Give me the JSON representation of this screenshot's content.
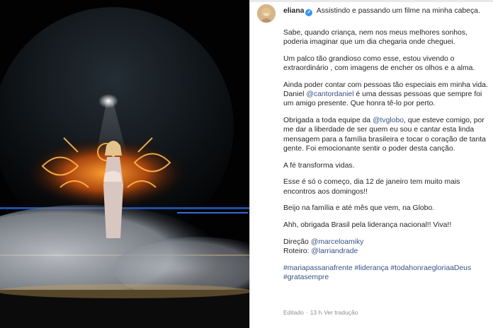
{
  "post": {
    "username": "eliana",
    "first_line": "Assistindo e passando um filme na minha cabeça.",
    "p1": "Sabe, quando criança, nem nos meus melhores sonhos, poderia imaginar que um dia chegaria onde cheguei.",
    "p2": "Um palco tão grandioso como esse, estou vivendo o extraordinário , com imagens de encher os olhos e a alma.",
    "p3_a": "Ainda poder contar com pessoas tão especiais em minha vida. Daniel ",
    "p3_mention": "@cantordaniel",
    "p3_b": " é uma dessas pessoas que sempre foi um amigo presente. Que honra tê-lo por perto.",
    "p4_a": "Obrigada a toda equipe da ",
    "p4_mention": "@tvglobo",
    "p4_b": ", que esteve comigo, por me dar a liberdade de ser quem eu sou e cantar esta linda mensagem para a família brasileira e tocar o coração de tanta gente. Foi emocionante sentir o poder desta canção.",
    "p5": "A fé transforma vidas.",
    "p6": "Esse é só o começo, dia 12 de janeiro tem muito mais encontros aos domingos!!",
    "p7": "Beijo na família e até mês que vem, na Globo.",
    "p8": "Ahh, obrigada Brasil pela liderança nacional!! Viva!!",
    "credit1_label": "Direção ",
    "credit1_mention": "@marceloamiky",
    "credit2_label": "Roteiro: ",
    "credit2_mention": "@larriandrade",
    "hashtags_line1": "#mariapassanafrente #liderança #todahonraegloriaaDeus",
    "hashtags_line2": "#gratasempre",
    "meta_edited": "Editado",
    "meta_sep": "·",
    "meta_time": "13 h",
    "meta_translation": "Ver tradução"
  },
  "colors": {
    "mention": "#385185",
    "meta": "#8e8e8e",
    "text": "#262626",
    "verified": "#3897f0"
  },
  "icons": [
    "verified-badge-icon"
  ]
}
